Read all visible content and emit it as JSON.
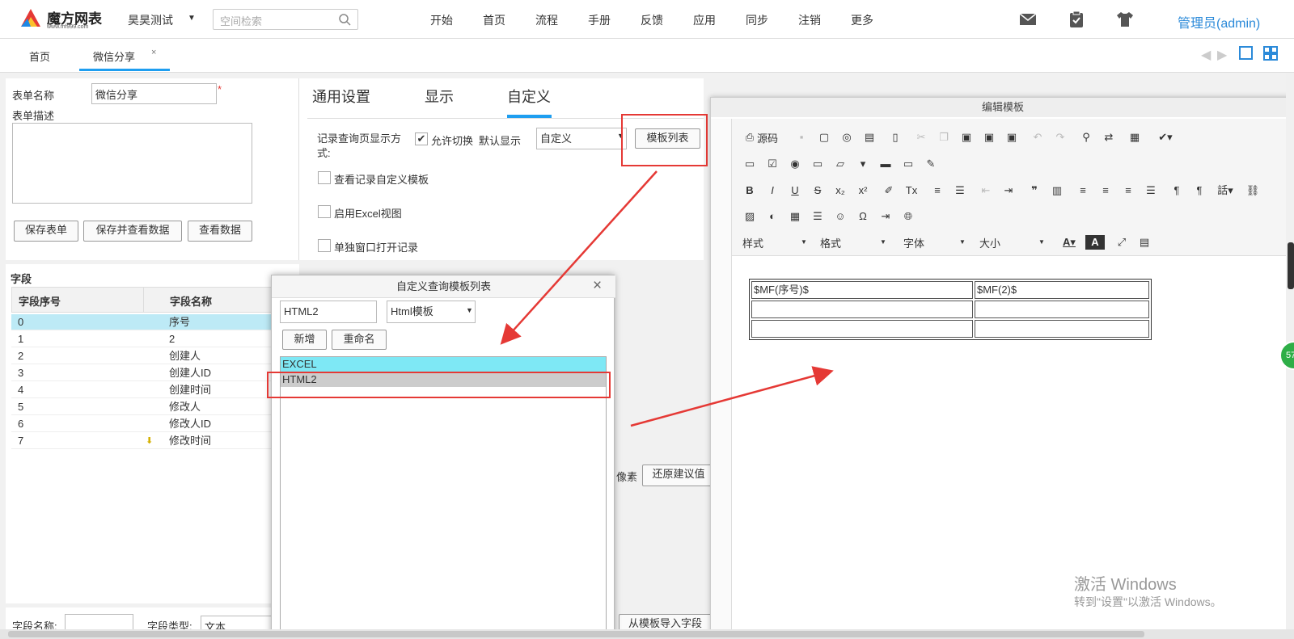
{
  "logo": {
    "title": "魔方网表",
    "url": "www.mf999.com"
  },
  "workspace": "昊昊测试",
  "search": {
    "placeholder": "空间检索"
  },
  "nav": [
    "开始",
    "首页",
    "流程",
    "手册",
    "反馈",
    "应用",
    "同步",
    "注销",
    "更多"
  ],
  "user": "管理员(admin)",
  "tabs": [
    "首页",
    "微信分享"
  ],
  "form": {
    "name_label": "表单名称",
    "name_value": "微信分享",
    "required_mark": "*",
    "desc_label": "表单描述",
    "buttons": [
      "保存表单",
      "保存并查看数据",
      "查看数据"
    ]
  },
  "settings": {
    "tabs": [
      "通用设置",
      "显示",
      "自定义"
    ],
    "display_mode_label": "记录查询页显示方式:",
    "allow_switch": "允许切换",
    "default_label": "默认显示",
    "default_value": "自定义",
    "template_list_btn": "模板列表",
    "options": [
      "查看记录自定义模板",
      "启用Excel视图",
      "单独窗口打开记录"
    ]
  },
  "fields": {
    "section_title": "字段",
    "col_seq": "字段序号",
    "col_name": "字段名称",
    "rows": [
      {
        "seq": "0",
        "name": "序号"
      },
      {
        "seq": "1",
        "name": "2"
      },
      {
        "seq": "2",
        "name": "创建人"
      },
      {
        "seq": "3",
        "name": "创建人ID"
      },
      {
        "seq": "4",
        "name": "创建时间"
      },
      {
        "seq": "5",
        "name": "修改人"
      },
      {
        "seq": "6",
        "name": "修改人ID"
      },
      {
        "seq": "7",
        "name": "修改时间"
      }
    ],
    "field_name_label": "字段名称:",
    "field_type_label": "字段类型:",
    "field_type_value": "文本",
    "pixel_label": "像素",
    "restore_btn": "还原建议值",
    "import_btn": "从模板导入字段"
  },
  "dialog1": {
    "title": "自定义查询模板列表",
    "name_value": "HTML2",
    "type_value": "Html模板",
    "add_btn": "新增",
    "rename_btn": "重命名",
    "items": [
      "EXCEL",
      "HTML2"
    ]
  },
  "dialog2": {
    "title": "编辑模板",
    "source_btn": "源码",
    "combos": [
      "样式",
      "格式",
      "字体",
      "大小"
    ],
    "table": [
      [
        "$MF(序号)$",
        "$MF(2)$"
      ],
      [
        "",
        ""
      ],
      [
        "",
        ""
      ]
    ]
  },
  "watermark": {
    "line1": "激活 Windows",
    "line2": "转到\"设置\"以激活 Windows。"
  },
  "badge": "57",
  "colors": {
    "accent": "#1e9ef0",
    "admin": "#2b8ad9",
    "highlight": "#7ee8f5",
    "annotation": "#e53935"
  }
}
